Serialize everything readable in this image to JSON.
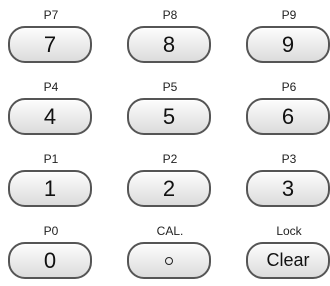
{
  "keys": [
    {
      "caption": "P7",
      "label": "7"
    },
    {
      "caption": "P8",
      "label": "8"
    },
    {
      "caption": "P9",
      "label": "9"
    },
    {
      "caption": "P4",
      "label": "4"
    },
    {
      "caption": "P5",
      "label": "5"
    },
    {
      "caption": "P6",
      "label": "6"
    },
    {
      "caption": "P1",
      "label": "1"
    },
    {
      "caption": "P2",
      "label": "2"
    },
    {
      "caption": "P3",
      "label": "3"
    },
    {
      "caption": "P0",
      "label": "0"
    },
    {
      "caption": "CAL.",
      "label": "",
      "icon": "circle-icon"
    },
    {
      "caption": "Lock",
      "label": "Clear"
    }
  ]
}
